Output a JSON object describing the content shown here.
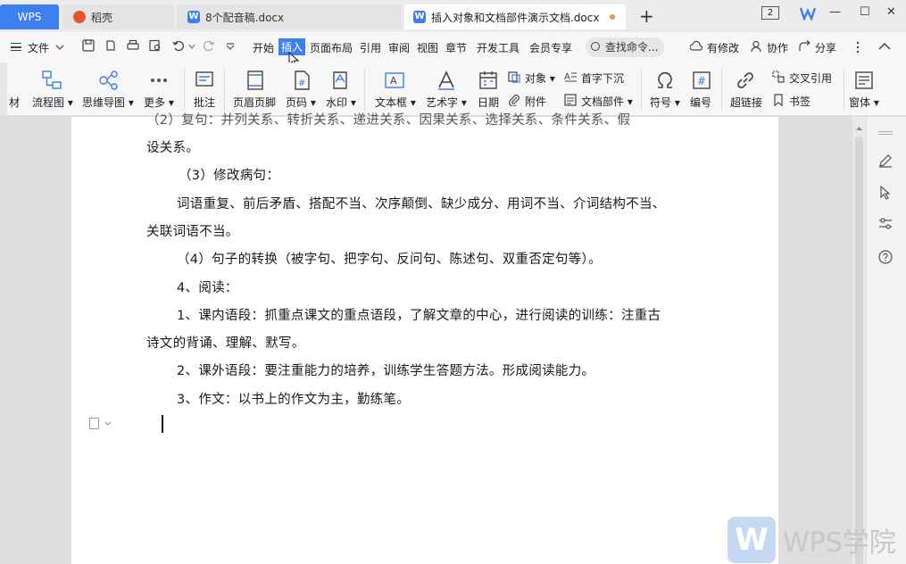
{
  "titlebar": {
    "tabs": [
      {
        "label": "WPS"
      },
      {
        "label": "稻壳"
      },
      {
        "label": "8个配音稿.docx"
      },
      {
        "label": "插入对象和文档部件演示文档.docx"
      }
    ],
    "add_tab": "+",
    "window_count": "2",
    "minimize": "—",
    "maximize": "☐",
    "close": "✕"
  },
  "menubar": {
    "file": "文件",
    "items": [
      "开始",
      "插入",
      "页面布局",
      "引用",
      "审阅",
      "视图",
      "章节",
      "开发工具",
      "会员专享"
    ],
    "active": "插入",
    "search_placeholder": "查找命令...",
    "right": [
      "有修改",
      "协作",
      "分享"
    ]
  },
  "ribbon": {
    "material": "材",
    "flowchart": "流程图",
    "mindmap": "思维导图",
    "more": "更多",
    "comment": "批注",
    "header_footer": "页眉页脚",
    "page_number": "页码",
    "watermark": "水印",
    "textbox": "文本框",
    "wordart": "艺术字",
    "date": "日期",
    "object": "对象",
    "attachment": "附件",
    "dropcap": "首字下沉",
    "doc_parts": "文档部件",
    "symbol": "符号",
    "numbering": "编号",
    "hyperlink": "超链接",
    "cross_ref": "交叉引用",
    "bookmark": "书签",
    "window": "窗体"
  },
  "document": {
    "lines": [
      "（2）复句：并列关系、转折关系、递进关系、因果关系、选择关系、条件关系、假",
      "设关系。",
      "（3）修改病句：",
      "词语重复、前后矛盾、搭配不当、次序颠倒、缺少成分、用词不当、介词结构不当、",
      "关联词语不当。",
      "（4）句子的转换（被字句、把字句、反问句、陈述句、双重否定句等）。",
      "4、阅读：",
      "1、课内语段：抓重点课文的重点语段，了解文章的中心，进行阅读的训练：注重古",
      "诗文的背诵、理解、默写。",
      "2、课外语段：要注重能力的培养，训练学生答题方法。形成阅读能力。",
      "3、作文：以书上的作文为主，勤练笔。"
    ]
  },
  "watermark": {
    "logo": "W",
    "text": "WPS学院"
  }
}
